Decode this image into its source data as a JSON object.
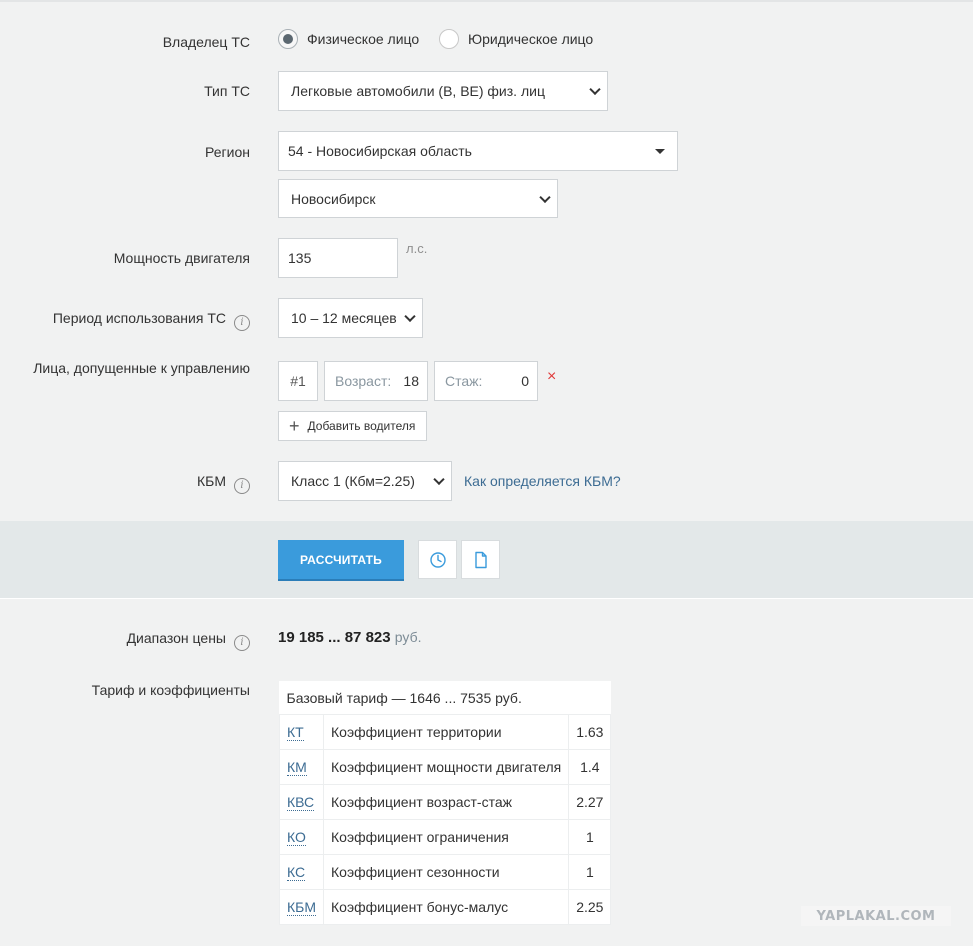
{
  "owner": {
    "label": "Владелец ТС",
    "options": [
      "Физическое лицо",
      "Юридическое лицо"
    ],
    "selected": "Физическое лицо"
  },
  "vehicle_type": {
    "label": "Тип ТС",
    "value": "Легковые автомобили (B, BE) физ. лиц"
  },
  "region": {
    "label": "Регион",
    "value": "54 - Новосибирская область",
    "city": "Новосибирск"
  },
  "engine_power": {
    "label": "Мощность двигателя",
    "value": "135",
    "unit": "л.с."
  },
  "usage_period": {
    "label": "Период использования ТС",
    "value": "10 – 12 месяцев"
  },
  "drivers": {
    "label": "Лица, допущенные к управлению",
    "items": [
      {
        "number": "#1",
        "age_label": "Возраст:",
        "age": "18",
        "exp_label": "Стаж:",
        "exp": "0"
      }
    ],
    "remove_glyph": "×",
    "add_label": "Добавить водителя"
  },
  "kbm": {
    "label": "КБМ",
    "value": "Класс 1 (Кбм=2.25)",
    "help_link": "Как определяется КБМ?"
  },
  "actions": {
    "calculate": "РАССЧИТАТЬ"
  },
  "result": {
    "price_label": "Диапазон цены",
    "price": "19 185 ... 87 823",
    "currency": "руб.",
    "tariff_label": "Тариф и коэффициенты",
    "base": "Базовый тариф — 1646 ... 7535 руб.",
    "rows": [
      {
        "abbr": "КТ",
        "name": "Коэффициент территории",
        "value": "1.63"
      },
      {
        "abbr": "КМ",
        "name": "Коэффициент мощности двигателя",
        "value": "1.4"
      },
      {
        "abbr": "КВС",
        "name": "Коэффициент возраст-стаж",
        "value": "2.27"
      },
      {
        "abbr": "КО",
        "name": "Коэффициент ограничения",
        "value": "1"
      },
      {
        "abbr": "КС",
        "name": "Коэффициент сезонности",
        "value": "1"
      },
      {
        "abbr": "КБМ",
        "name": "Коэффициент бонус-малус",
        "value": "2.25"
      }
    ]
  },
  "watermark": "YAPLAKAL.COM",
  "colors": {
    "accent": "#3a9bdc",
    "link": "#3d6c93",
    "remove": "#e03a3a",
    "bar": "#e3e8e9",
    "background": "#f1f2f2"
  }
}
